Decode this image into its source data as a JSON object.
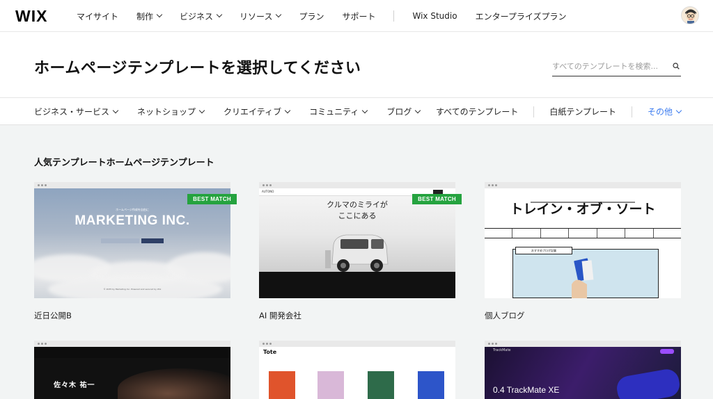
{
  "topnav": {
    "logo": "WIX",
    "items": [
      {
        "label": "マイサイト",
        "dropdown": false
      },
      {
        "label": "制作",
        "dropdown": true
      },
      {
        "label": "ビジネス",
        "dropdown": true
      },
      {
        "label": "リソース",
        "dropdown": true
      },
      {
        "label": "プラン",
        "dropdown": false
      },
      {
        "label": "サポート",
        "dropdown": false
      }
    ],
    "extra": [
      {
        "label": "Wix Studio"
      },
      {
        "label": "エンタープライズプラン"
      }
    ]
  },
  "header": {
    "title": "ホームページテンプレートを選択してください",
    "search_placeholder": "すべてのテンプレートを検索..."
  },
  "categories": {
    "left": [
      "ビジネス・サービス",
      "ネットショップ",
      "クリエイティブ",
      "コミュニティ",
      "ブログ"
    ],
    "right": [
      "すべてのテンプレート",
      "白紙テンプレート"
    ],
    "more": "その他",
    "accent": "#3b7bf0"
  },
  "section": {
    "title": "人気テンプレートホームページテンプレート"
  },
  "cards": [
    {
      "label": "近日公開B",
      "badge": "BEST MATCH",
      "preview_title": "MARKETING INC.",
      "preview_sub": "ホームページ作成を自由に",
      "preview_foot": "© 2035 by Marketing Inc. Powered and secured by Wix"
    },
    {
      "label": "AI 開発会社",
      "badge": "BEST MATCH",
      "preview_title_1": "クルマのミライが",
      "preview_title_2": "ここにある",
      "preview_brand": "AUTONO"
    },
    {
      "label": "個人ブログ",
      "badge": "",
      "preview_title": "トレイン・オブ・ソート",
      "preview_tab": "おすすめブログ記事"
    }
  ],
  "row2": [
    {
      "preview_name": "佐々木 祐一"
    },
    {
      "preview_brand": "Tote"
    },
    {
      "preview_title": "0.4 TrackMate XE",
      "preview_brand": "TrackMate"
    }
  ],
  "colors": {
    "badge": "#25a33f"
  }
}
